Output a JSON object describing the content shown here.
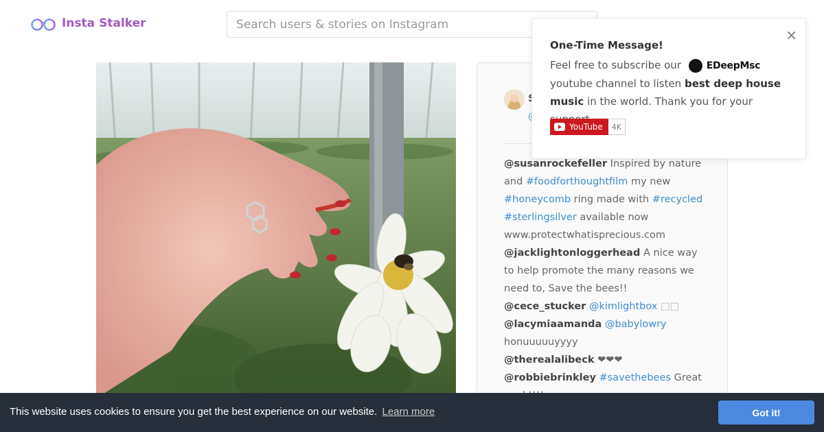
{
  "header": {
    "logo_text": "Insta Stalker",
    "search_placeholder": "Search users & stories on Instagram"
  },
  "post": {
    "image_alt": "Hand wearing silver honeycomb ring next to white dahlia with bee",
    "user_initial": "S",
    "user_handle": "@",
    "comments": [
      {
        "user": "@susanrockefeller",
        "text_parts": [
          {
            "t": " Inspired by nature and ",
            "k": "text"
          },
          {
            "t": "#foodforthoughtfilm",
            "k": "hash"
          },
          {
            "t": " my new ",
            "k": "text"
          },
          {
            "t": "#honeycomb",
            "k": "hash"
          },
          {
            "t": " ring made with ",
            "k": "text"
          },
          {
            "t": "#recycled",
            "k": "hash"
          },
          {
            "t": " ",
            "k": "text"
          },
          {
            "t": "#sterlingsilver",
            "k": "hash"
          },
          {
            "t": " available now www.protectwhatisprecious.com",
            "k": "text"
          }
        ]
      },
      {
        "user": "@jacklightonloggerhead",
        "text_parts": [
          {
            "t": " A nice way to help promote the many reasons we need to, Save the bees!!",
            "k": "text"
          }
        ]
      },
      {
        "user": "@cece_stucker",
        "text_parts": [
          {
            "t": " ",
            "k": "text"
          },
          {
            "t": "@kimlightbox",
            "k": "hash"
          },
          {
            "t": " □□",
            "k": "muted"
          }
        ]
      },
      {
        "user": "@lacymiaamanda",
        "text_parts": [
          {
            "t": " ",
            "k": "text"
          },
          {
            "t": "@babylowry",
            "k": "hash"
          },
          {
            "t": " honuuuuuyyyy",
            "k": "text"
          }
        ]
      },
      {
        "user": "@therealalibeck",
        "text_parts": [
          {
            "t": " ❤❤❤",
            "k": "text"
          }
        ]
      },
      {
        "user": "@robbiebrinkley",
        "text_parts": [
          {
            "t": " ",
            "k": "text"
          },
          {
            "t": "#savethebees",
            "k": "hash"
          },
          {
            "t": " Great work!!!!",
            "k": "text"
          }
        ]
      }
    ]
  },
  "popup": {
    "title": "One-Time Message!",
    "body_prefix": "Feel free to subscribe our",
    "brand_name": "EDeepMsc",
    "body_middle": "youtube channel to listen",
    "body_bold": "best deep house music",
    "body_suffix": "in the world. Thank you for your support.",
    "close_symbol": "×",
    "youtube_label": "YouTube",
    "youtube_count": "4K"
  },
  "cookie": {
    "message": "This website uses cookies to ensure you get the best experience on our website.",
    "learn_more": "Learn more",
    "accept": "Got it!"
  },
  "colors": {
    "brand": "#a05bc4",
    "link": "#3d8ed2",
    "cookie_bg": "#252e39",
    "cookie_button": "#4b8ae0",
    "youtube_red": "#cc181e"
  }
}
